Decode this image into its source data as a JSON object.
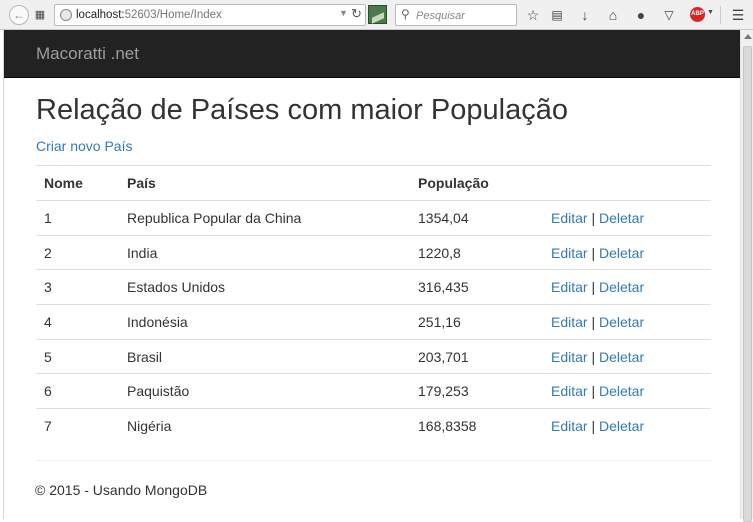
{
  "browser": {
    "url_host": "localhost:",
    "url_port": "52603",
    "url_path": "/Home/Index",
    "search_placeholder": "Pesquisar",
    "abp_label": "ABP"
  },
  "navbar": {
    "brand": "Macoratti .net"
  },
  "main": {
    "title": "Relação de Países com maior População",
    "create_link": "Criar novo País",
    "table": {
      "headers": [
        "Nome",
        "País",
        "População",
        ""
      ],
      "edit_label": "Editar",
      "separator": "|",
      "delete_label": "Deletar",
      "rows": [
        {
          "nome": "1",
          "pais": "Republica Popular da China",
          "populacao": "1354,04"
        },
        {
          "nome": "2",
          "pais": "India",
          "populacao": "1220,8"
        },
        {
          "nome": "3",
          "pais": "Estados Unidos",
          "populacao": "316,435"
        },
        {
          "nome": "4",
          "pais": "Indonésia",
          "populacao": "251,16"
        },
        {
          "nome": "5",
          "pais": "Brasil",
          "populacao": "203,701"
        },
        {
          "nome": "6",
          "pais": "Paquistão",
          "populacao": "179,253"
        },
        {
          "nome": "7",
          "pais": "Nigéria",
          "populacao": "168,8358"
        }
      ]
    }
  },
  "footer": {
    "text": "© 2015 - Usando MongoDB"
  },
  "colors": {
    "navbar_bg": "#222222",
    "brand_text": "#9d9d9d",
    "link": "#337ab7",
    "text": "#333333"
  }
}
